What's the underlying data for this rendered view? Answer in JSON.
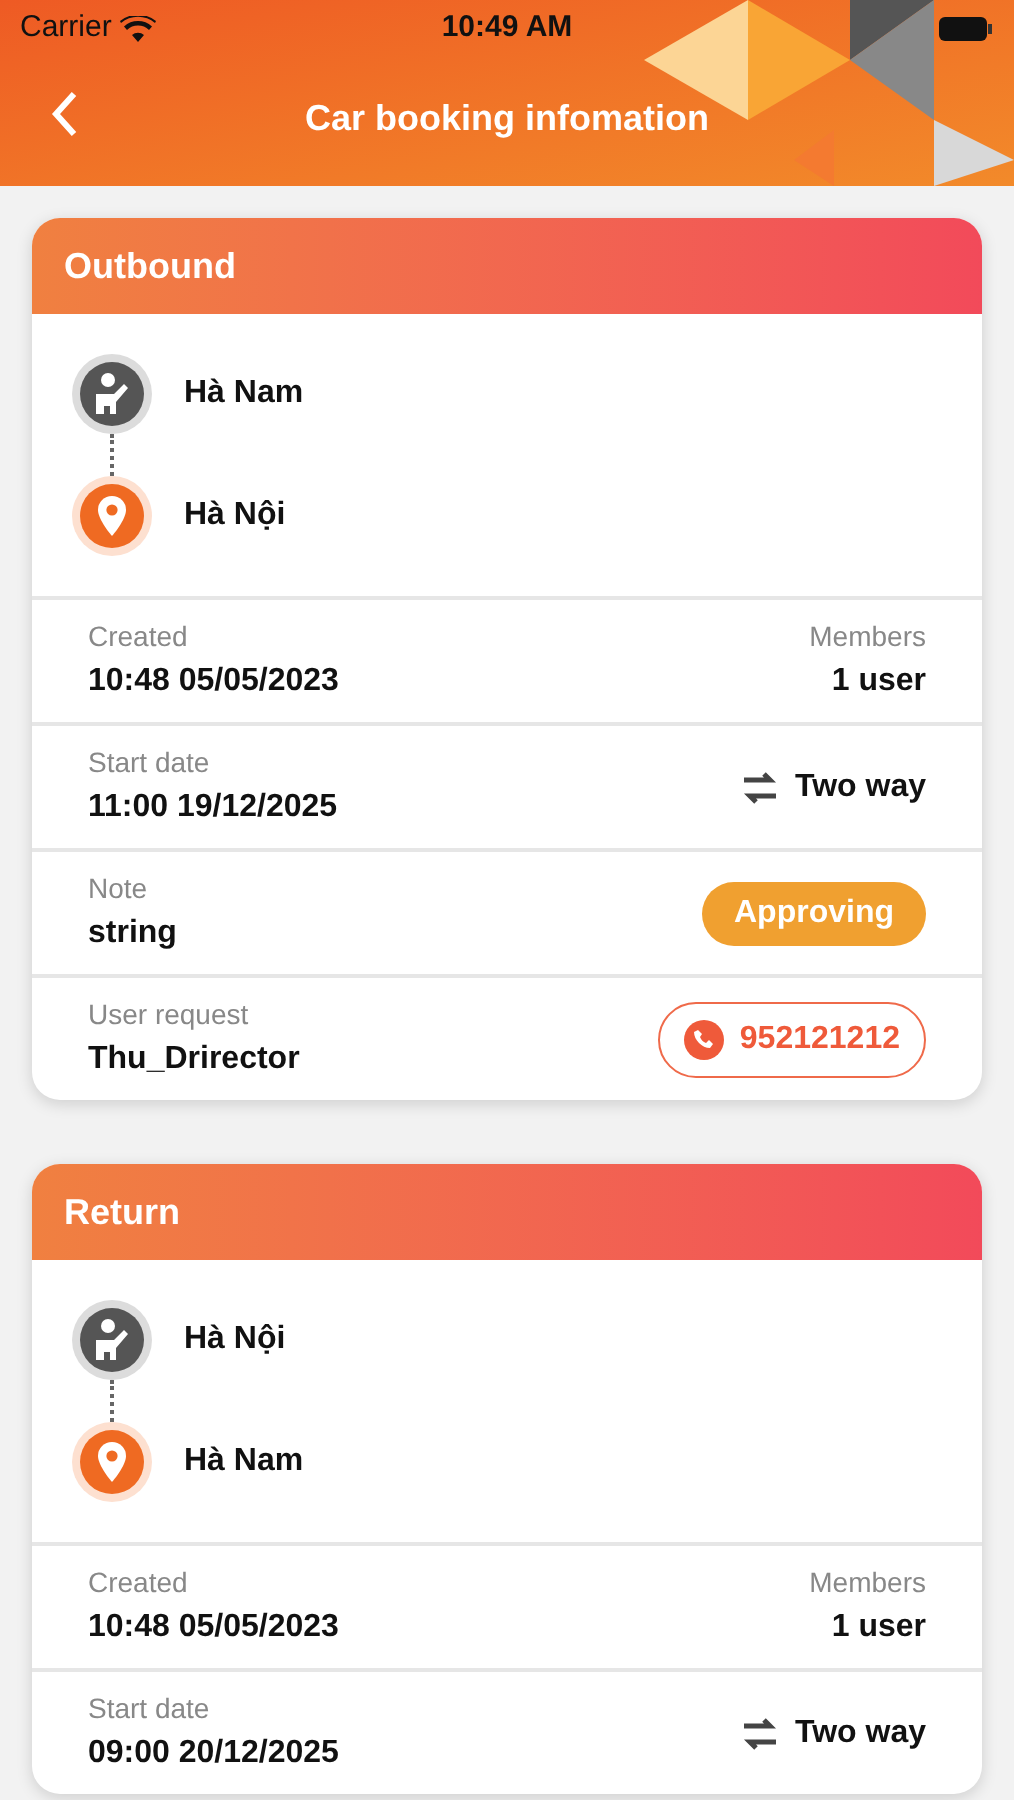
{
  "status_bar": {
    "carrier": "Carrier",
    "time": "10:49 AM"
  },
  "header": {
    "title": "Car booking infomation"
  },
  "trips": [
    {
      "title": "Outbound",
      "route": [
        {
          "kind": "origin",
          "place": "Hà Nam"
        },
        {
          "kind": "destination",
          "place": "Hà Nội"
        }
      ],
      "rows": [
        {
          "label": "Created",
          "value": "10:48 05/05/2023",
          "right": {
            "kind": "info",
            "label": "Members",
            "value": "1 user"
          }
        },
        {
          "label": "Start date",
          "value": "11:00 19/12/2025",
          "right": {
            "kind": "trip",
            "value": "Two way"
          }
        },
        {
          "label": "Note",
          "value": "string",
          "right": {
            "kind": "status",
            "value": "Approving"
          }
        },
        {
          "label": "User request",
          "value": "Thu_Drirector",
          "right": {
            "kind": "phone",
            "value": "952121212"
          }
        }
      ]
    },
    {
      "title": "Return",
      "route": [
        {
          "kind": "origin",
          "place": "Hà Nội"
        },
        {
          "kind": "destination",
          "place": "Hà Nam"
        }
      ],
      "rows": [
        {
          "label": "Created",
          "value": "10:48 05/05/2023",
          "right": {
            "kind": "info",
            "label": "Members",
            "value": "1 user"
          }
        },
        {
          "label": "Start date",
          "value": "09:00 20/12/2025",
          "right": {
            "kind": "trip",
            "value": "Two way"
          }
        }
      ]
    }
  ]
}
